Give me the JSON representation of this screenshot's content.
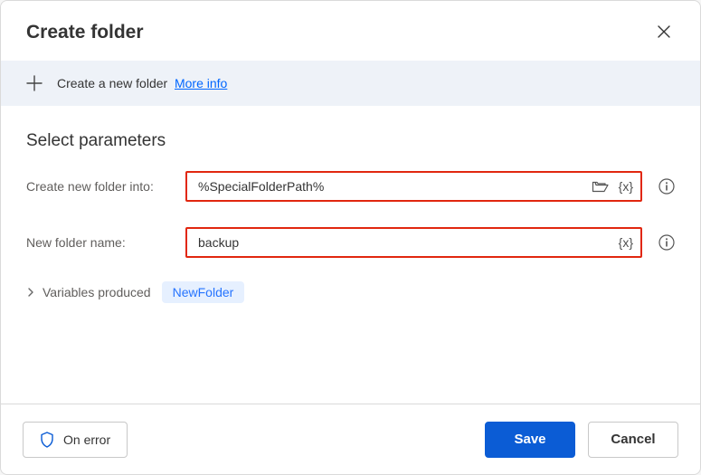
{
  "header": {
    "title": "Create folder"
  },
  "info": {
    "text": "Create a new folder",
    "more_info": "More info"
  },
  "section": {
    "title": "Select parameters"
  },
  "fields": {
    "into": {
      "label": "Create new folder into:",
      "value": "%SpecialFolderPath%"
    },
    "name": {
      "label": "New folder name:",
      "value": "backup"
    }
  },
  "vars": {
    "label": "Variables produced",
    "value": "NewFolder"
  },
  "footer": {
    "on_error": "On error",
    "save": "Save",
    "cancel": "Cancel"
  }
}
